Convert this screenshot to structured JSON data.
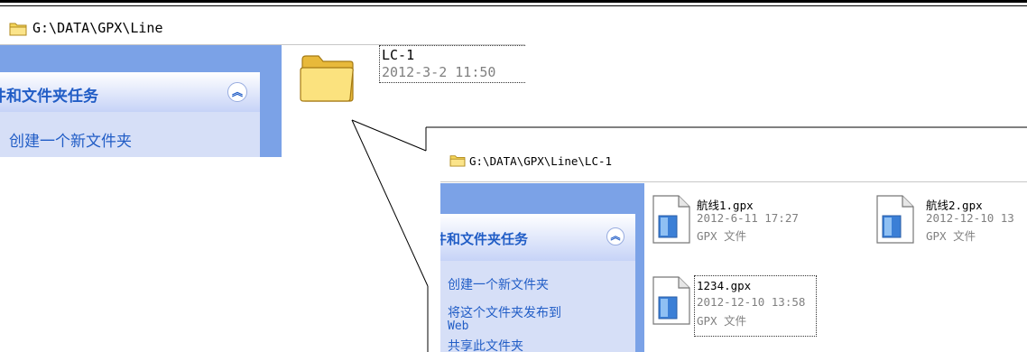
{
  "window1": {
    "address": "G:\\DATA\\GPX\\Line",
    "task_header": "件和文件夹任务",
    "tasks": [
      "创建一个新文件夹"
    ],
    "folder": {
      "name": "LC-1",
      "date": "2012-3-2 11:50"
    }
  },
  "window2": {
    "address": "G:\\DATA\\GPX\\Line\\LC-1",
    "task_header": "件和文件夹任务",
    "tasks": [
      "创建一个新文件夹",
      "将这个文件夹发布到",
      "Web",
      "共享此文件夹"
    ],
    "files": [
      {
        "name": "航线1.gpx",
        "date": "2012-6-11 17:27",
        "type": "GPX 文件"
      },
      {
        "name": "航线2.gpx",
        "date": "2012-12-10 13",
        "type": "GPX 文件"
      },
      {
        "name": "1234.gpx",
        "date": "2012-12-10 13:58",
        "type": "GPX 文件"
      }
    ]
  },
  "icons": [
    "folder-icon",
    "collapse-chevron-icon",
    "gpx-file-icon"
  ],
  "colors": {
    "task_pane": "#7ba2e7",
    "task_box": "#d6dff7",
    "link": "#215dc6",
    "folder": "#f5d65a"
  }
}
